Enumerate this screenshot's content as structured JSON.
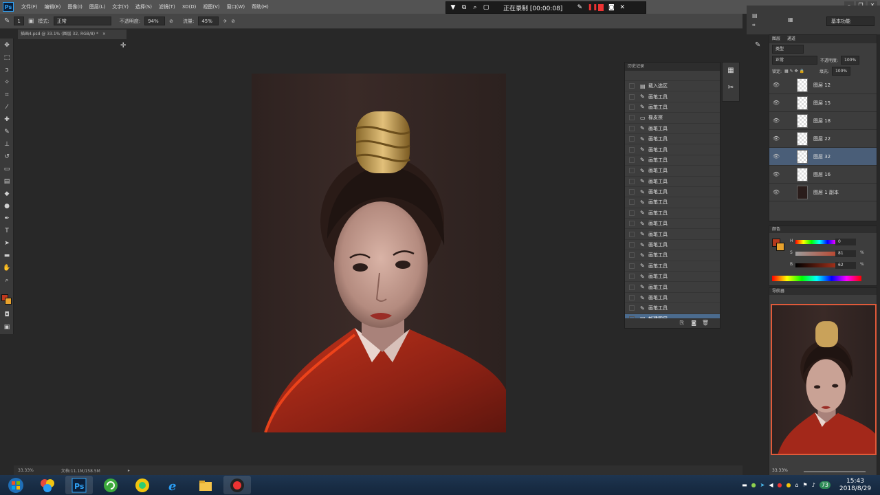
{
  "app": {
    "name": "Photoshop",
    "logo_text": "Ps"
  },
  "menubar": {
    "items": [
      "文件(F)",
      "编辑(E)",
      "图像(I)",
      "图层(L)",
      "文字(Y)",
      "选择(S)",
      "滤镜(T)",
      "3D(D)",
      "视图(V)",
      "窗口(W)",
      "帮助(H)"
    ]
  },
  "recorder": {
    "status": "正在录制 [00:00:08]"
  },
  "options": {
    "brush_size": "1",
    "mode_label": "模式:",
    "mode_value": "正常",
    "opacity_label": "不透明度:",
    "opacity_value": "94%",
    "flow_label": "流量:",
    "flow_value": "45%"
  },
  "document": {
    "tab_title": "插画4.psd @ 33.1% (图层 32, RGB/8) *",
    "close": "×"
  },
  "status": {
    "zoom": "33.33%",
    "doc_size": "文档:11.1M/158.5M"
  },
  "history": {
    "title": "历史记录",
    "items": [
      {
        "label": "载入选区",
        "icon": "doc-icon"
      },
      {
        "label": "画笔工具",
        "icon": "brush-icon"
      },
      {
        "label": "画笔工具",
        "icon": "brush-icon"
      },
      {
        "label": "橡皮擦",
        "icon": "eraser-icon"
      },
      {
        "label": "画笔工具",
        "icon": "brush-icon"
      },
      {
        "label": "画笔工具",
        "icon": "brush-icon"
      },
      {
        "label": "画笔工具",
        "icon": "brush-icon"
      },
      {
        "label": "画笔工具",
        "icon": "brush-icon"
      },
      {
        "label": "画笔工具",
        "icon": "brush-icon"
      },
      {
        "label": "画笔工具",
        "icon": "brush-icon"
      },
      {
        "label": "画笔工具",
        "icon": "brush-icon"
      },
      {
        "label": "画笔工具",
        "icon": "brush-icon"
      },
      {
        "label": "画笔工具",
        "icon": "brush-icon"
      },
      {
        "label": "画笔工具",
        "icon": "brush-icon"
      },
      {
        "label": "画笔工具",
        "icon": "brush-icon"
      },
      {
        "label": "画笔工具",
        "icon": "brush-icon"
      },
      {
        "label": "画笔工具",
        "icon": "brush-icon"
      },
      {
        "label": "画笔工具",
        "icon": "brush-icon"
      },
      {
        "label": "画笔工具",
        "icon": "brush-icon"
      },
      {
        "label": "画笔工具",
        "icon": "brush-icon"
      },
      {
        "label": "画笔工具",
        "icon": "brush-icon"
      },
      {
        "label": "画笔工具",
        "icon": "brush-icon"
      },
      {
        "label": "新建图层",
        "icon": "doc-icon"
      }
    ]
  },
  "workspace": {
    "essentials": "基本功能"
  },
  "layers": {
    "tabs": [
      "图层",
      "通道"
    ],
    "filter": "类型",
    "blend": "正常",
    "opacity_label": "不透明度:",
    "opacity_value": "100%",
    "lock_label": "锁定:",
    "fill_label": "填充:",
    "fill_value": "100%",
    "items": [
      "图层 12",
      "图层 15",
      "图层 18",
      "图层 22",
      "图层 32",
      "图层 16",
      "图层 1 副本"
    ],
    "selected_index": 4
  },
  "color": {
    "title": "颜色",
    "h_label": "H",
    "h_value": "0",
    "s_label": "S",
    "s_value": "81",
    "b_label": "B",
    "b_value": "62",
    "pct": "%",
    "fg_color": "#b5391c",
    "bg_color": "#e8a22d"
  },
  "navigator": {
    "title": "导航器",
    "zoom": "33.33%"
  },
  "taskbar": {
    "clock_time": "15:43",
    "clock_date": "2018/8/29",
    "badge": "73"
  }
}
